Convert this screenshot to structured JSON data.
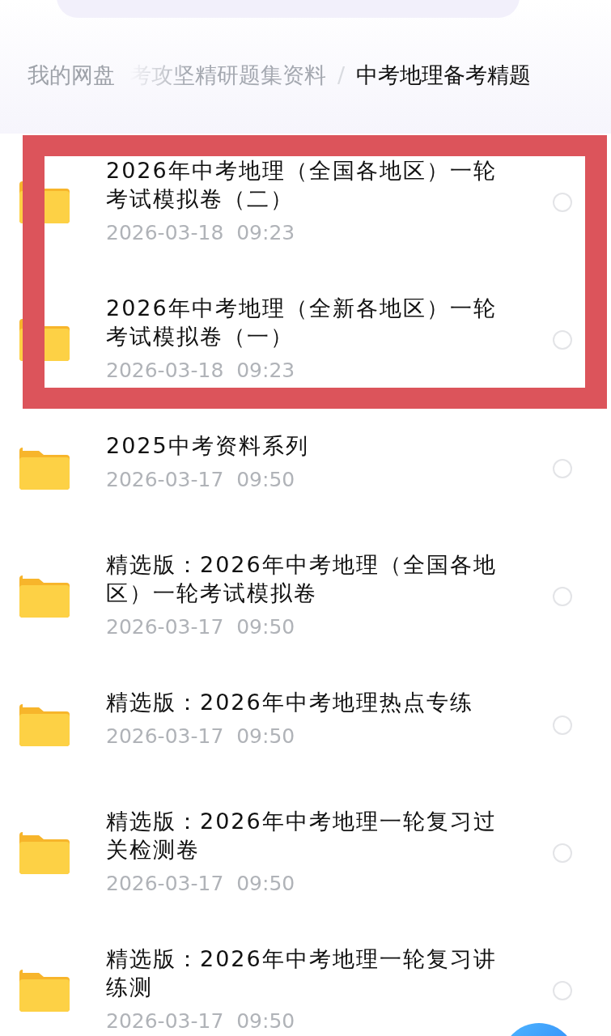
{
  "breadcrumb": [
    {
      "kind": "link",
      "label": "我的网盘",
      "current": false
    },
    {
      "kind": "link",
      "label": "考攻坚精研题集资料",
      "current": false
    },
    {
      "kind": "separator",
      "label": "/"
    },
    {
      "kind": "link",
      "label": "中考地理备考精题",
      "current": true
    }
  ],
  "files": [
    {
      "name": "2026年中考地理（全国各地区）一轮考试模拟卷（二）",
      "date": "2026-03-18  09:23",
      "selected": false,
      "highlighted": true
    },
    {
      "name": "2026年中考地理（全新各地区）一轮考试模拟卷（一）",
      "date": "2026-03-18  09:23",
      "selected": false,
      "highlighted": true
    },
    {
      "name": "2025中考资料系列",
      "date": "2026-03-17  09:50",
      "selected": false,
      "highlighted": false
    },
    {
      "name": "精选版：2026年中考地理（全国各地区）一轮考试模拟卷",
      "date": "2026-03-17  09:50",
      "selected": false,
      "highlighted": false
    },
    {
      "name": "精选版：2026年中考地理热点专练",
      "date": "2026-03-17  09:50",
      "selected": false,
      "highlighted": false
    },
    {
      "name": "精选版：2026年中考地理一轮复习过关检测卷",
      "date": "2026-03-17  09:50",
      "selected": false,
      "highlighted": false
    },
    {
      "name": "精选版：2026年中考地理一轮复习讲练测",
      "date": "2026-03-17  09:50",
      "selected": false,
      "highlighted": false
    }
  ]
}
